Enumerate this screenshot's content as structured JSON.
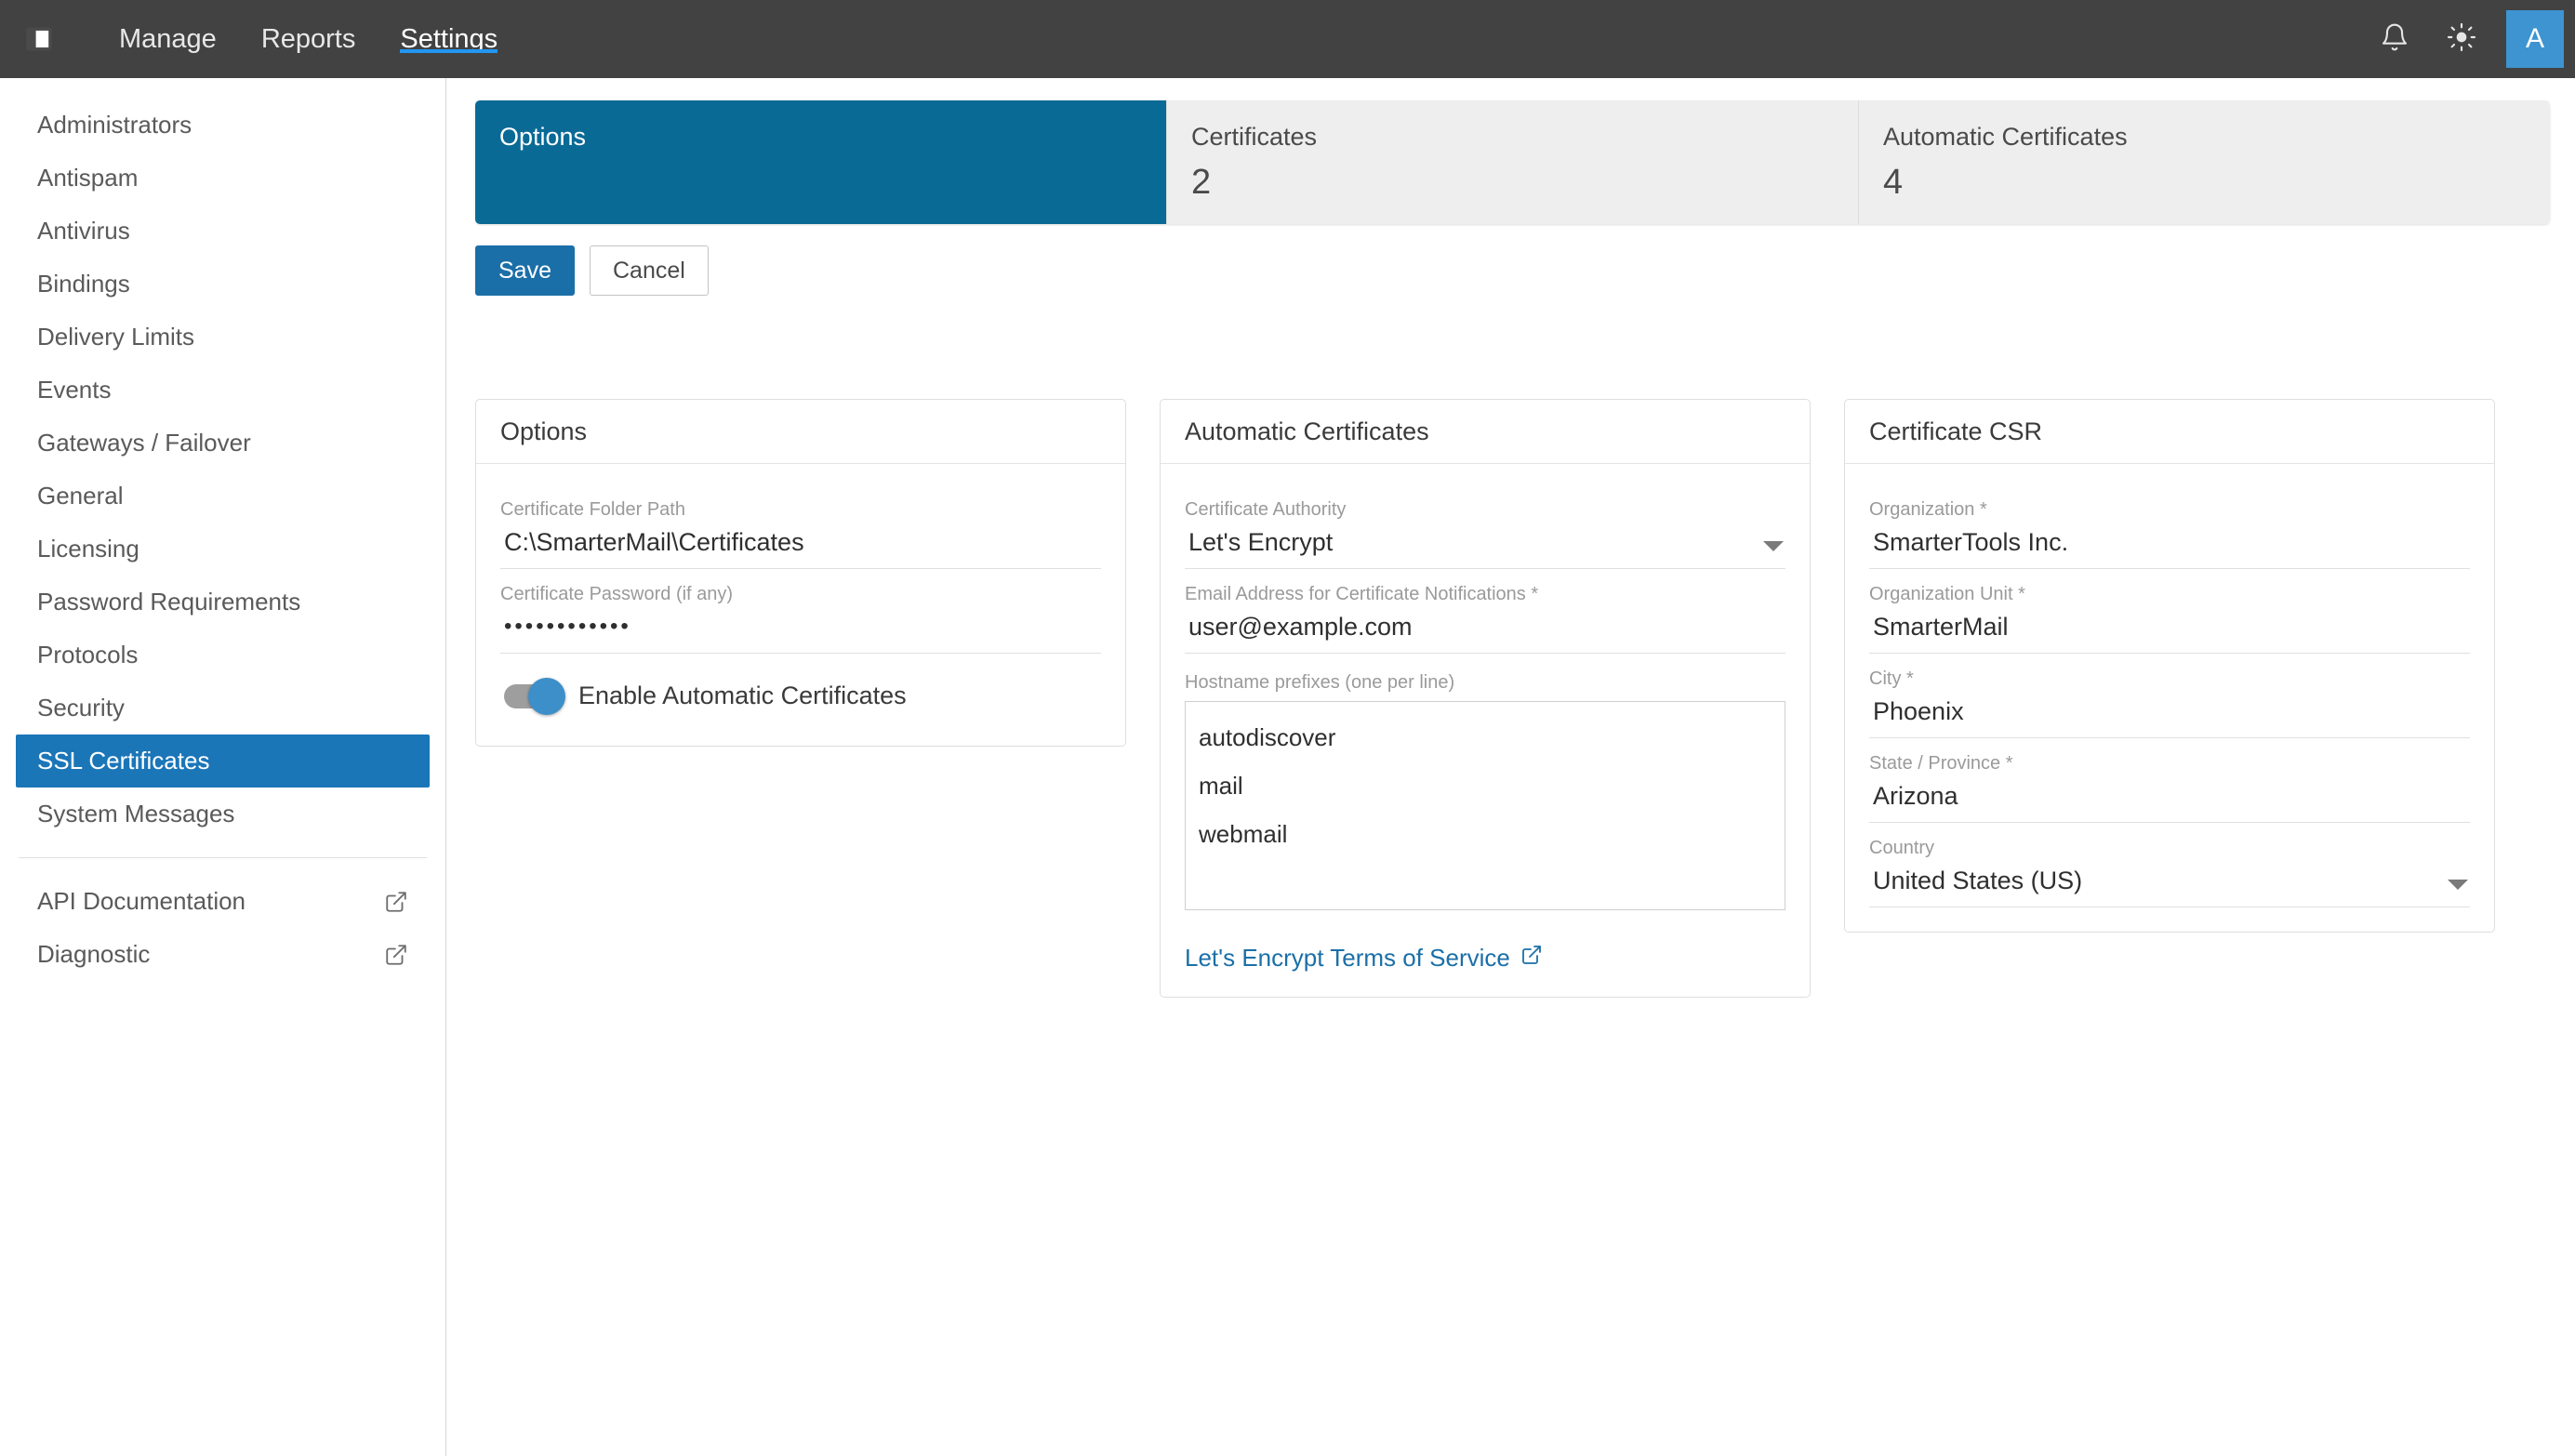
{
  "topnav": {
    "panel_toggle_icon": "sidebar-panel-icon",
    "items": [
      {
        "label": "Manage",
        "active": false
      },
      {
        "label": "Reports",
        "active": false
      },
      {
        "label": "Settings",
        "active": true
      }
    ],
    "notifications_icon": "bell-icon",
    "theme_icon": "sun-icon",
    "avatar_label": "A",
    "accent_underline": "#2196f3"
  },
  "sidebar": {
    "items": [
      {
        "label": "Administrators",
        "active": false,
        "external": false
      },
      {
        "label": "Antispam",
        "active": false,
        "external": false
      },
      {
        "label": "Antivirus",
        "active": false,
        "external": false
      },
      {
        "label": "Bindings",
        "active": false,
        "external": false
      },
      {
        "label": "Delivery Limits",
        "active": false,
        "external": false
      },
      {
        "label": "Events",
        "active": false,
        "external": false
      },
      {
        "label": "Gateways / Failover",
        "active": false,
        "external": false
      },
      {
        "label": "General",
        "active": false,
        "external": false
      },
      {
        "label": "Licensing",
        "active": false,
        "external": false
      },
      {
        "label": "Password Requirements",
        "active": false,
        "external": false
      },
      {
        "label": "Protocols",
        "active": false,
        "external": false
      },
      {
        "label": "Security",
        "active": false,
        "external": false
      },
      {
        "label": "SSL Certificates",
        "active": true,
        "external": false
      },
      {
        "label": "System Messages",
        "active": false,
        "external": false
      }
    ],
    "footer_items": [
      {
        "label": "API Documentation",
        "external": true,
        "icon": "external-link-icon"
      },
      {
        "label": "Diagnostic",
        "external": true,
        "icon": "external-link-icon"
      }
    ],
    "active_color": "#1b76b8"
  },
  "tabs": {
    "active_color": "#0a6a96",
    "inactive_color": "#eeeeee",
    "items": [
      {
        "label": "Options",
        "count": "",
        "active": true
      },
      {
        "label": "Certificates",
        "count": "2",
        "active": false
      },
      {
        "label": "Automatic Certificates",
        "count": "4",
        "active": false
      }
    ]
  },
  "toolbar": {
    "save_label": "Save",
    "cancel_label": "Cancel",
    "primary_color": "#1b6fa8"
  },
  "options_card": {
    "title": "Options",
    "folder_path": {
      "label": "Certificate Folder Path",
      "value": "C:\\SmarterMail\\Certificates"
    },
    "password": {
      "label": "Certificate Password (if any)",
      "value": "••••••••••••"
    },
    "toggle": {
      "label": "Enable Automatic Certificates",
      "state": "on",
      "on_color": "#3d8fc9"
    }
  },
  "automatic_card": {
    "title": "Automatic Certificates",
    "certificate_authority": {
      "label": "Certificate Authority",
      "value": "Let's Encrypt",
      "icon": "chevron-down-icon"
    },
    "email": {
      "label": "Email Address for Certificate Notifications *",
      "value": "user@example.com"
    },
    "hostname_prefixes": {
      "label": "Hostname prefixes (one per line)",
      "lines": [
        "autodiscover",
        "mail",
        "webmail"
      ]
    },
    "tos_link": {
      "label": "Let's Encrypt Terms of Service",
      "icon": "external-link-icon",
      "color": "#1b6fa8"
    }
  },
  "csr_card": {
    "title": "Certificate CSR",
    "fields": [
      {
        "label": "Organization *",
        "value": "SmarterTools Inc.",
        "type": "text"
      },
      {
        "label": "Organization Unit *",
        "value": "SmarterMail",
        "type": "text"
      },
      {
        "label": "City *",
        "value": "Phoenix",
        "type": "text"
      },
      {
        "label": "State / Province *",
        "value": "Arizona",
        "type": "text"
      },
      {
        "label": "Country",
        "value": "United States (US)",
        "type": "select"
      }
    ]
  }
}
